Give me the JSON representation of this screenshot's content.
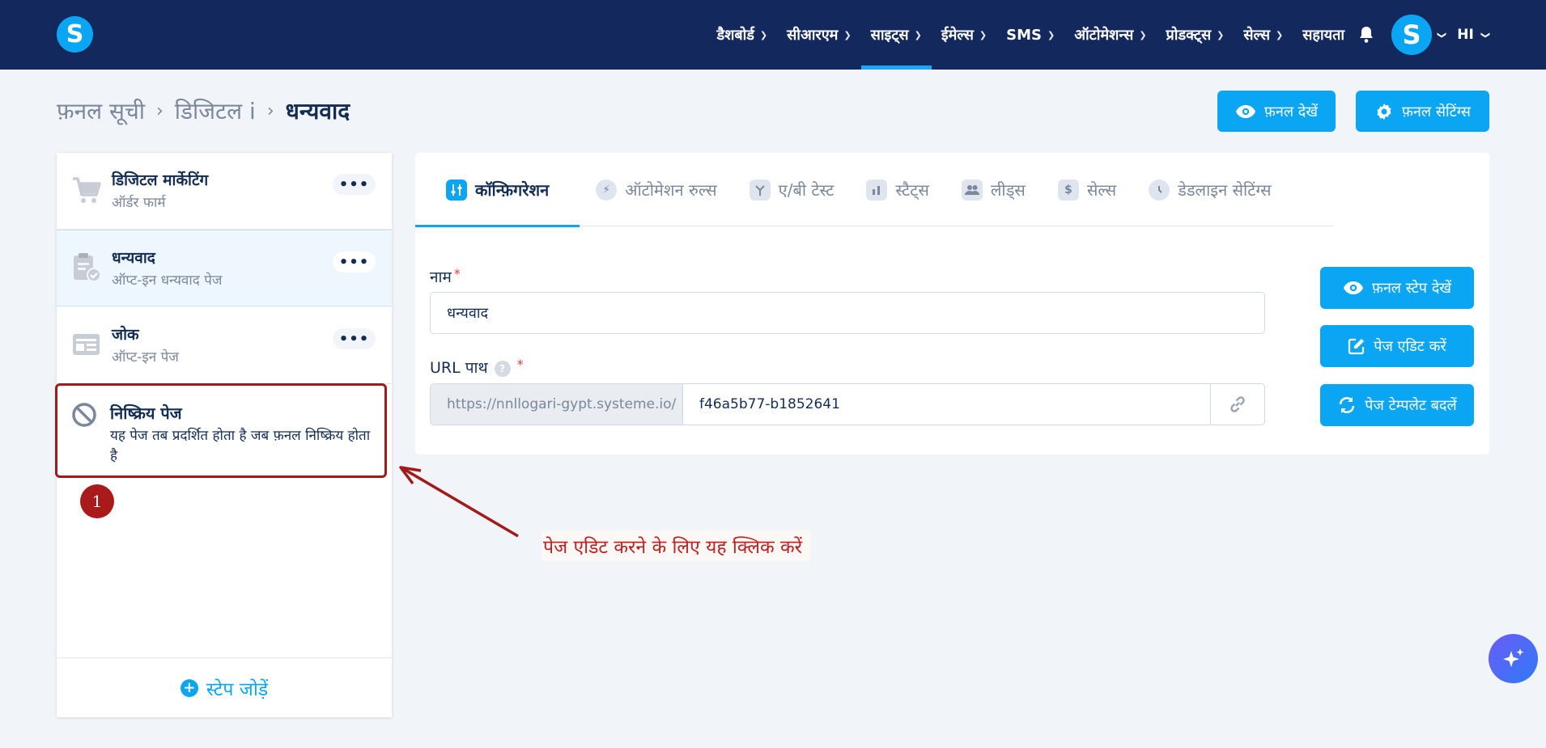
{
  "app": {
    "logo_letter": "S"
  },
  "nav": {
    "items": [
      {
        "label": "डैशबोर्ड"
      },
      {
        "label": "सीआरएम"
      },
      {
        "label": "साइट्स"
      },
      {
        "label": "ईमेल्स"
      },
      {
        "label": "SMS"
      },
      {
        "label": "ऑटोमेशन्स"
      },
      {
        "label": "प्रोडक्ट्स"
      },
      {
        "label": "सेल्स"
      }
    ],
    "help": "सहायता",
    "avatar_letter": "S",
    "language": "HI"
  },
  "breadcrumb": {
    "root": "फ़नल सूची",
    "middle": "डिजिटल i",
    "current": "धन्यवाद"
  },
  "header_buttons": {
    "view_funnel": "फ़नल देखें",
    "funnel_settings": "फ़नल सेटिंग्स"
  },
  "steps": [
    {
      "title": "डिजिटल मार्केटिंग",
      "subtitle": "ऑर्डर फार्म",
      "more": "•••"
    },
    {
      "title": "धन्यवाद",
      "subtitle": "ऑप्ट-इन धन्यवाद पेज",
      "more": "•••"
    },
    {
      "title": "जोक",
      "subtitle": "ऑप्ट-इन पेज",
      "more": "•••"
    }
  ],
  "inactive_step": {
    "title": "निष्क्रिय पेज",
    "subtitle": "यह पेज तब प्रदर्शित होता है जब फ़नल निष्क्रिय होता है"
  },
  "add_step": "स्टेप जोड़ें",
  "tabs": [
    {
      "label": "कॉन्फ़िगरेशन"
    },
    {
      "label": "ऑटोमेशन रुल्स"
    },
    {
      "label": "ए/बी टेस्ट"
    },
    {
      "label": "स्टैट्स"
    },
    {
      "label": "लीड्स"
    },
    {
      "label": "सेल्स"
    },
    {
      "label": "डेडलाइन सेटिंग्स"
    }
  ],
  "form": {
    "name_label": "नाम",
    "name_value": "धन्यवाद",
    "url_label": "URL पाथ",
    "url_prefix": "https://nnllogari-gypt.systeme.io/",
    "url_value": "f46a5b77-b1852641",
    "required_mark": "*",
    "help_mark": "?"
  },
  "side_buttons": {
    "view_step": "फ़नल स्टेप देखें",
    "edit_page": "पेज एडिट करें",
    "change_template": "पेज टेम्पलेट बदलें"
  },
  "annotation": {
    "badge": "1",
    "text": "पेज एडिट करने के लिए यह क्लिक करें"
  },
  "colors": {
    "nav_bg": "#13285c",
    "accent": "#0aa6f3",
    "annotation": "#a11b1b"
  }
}
